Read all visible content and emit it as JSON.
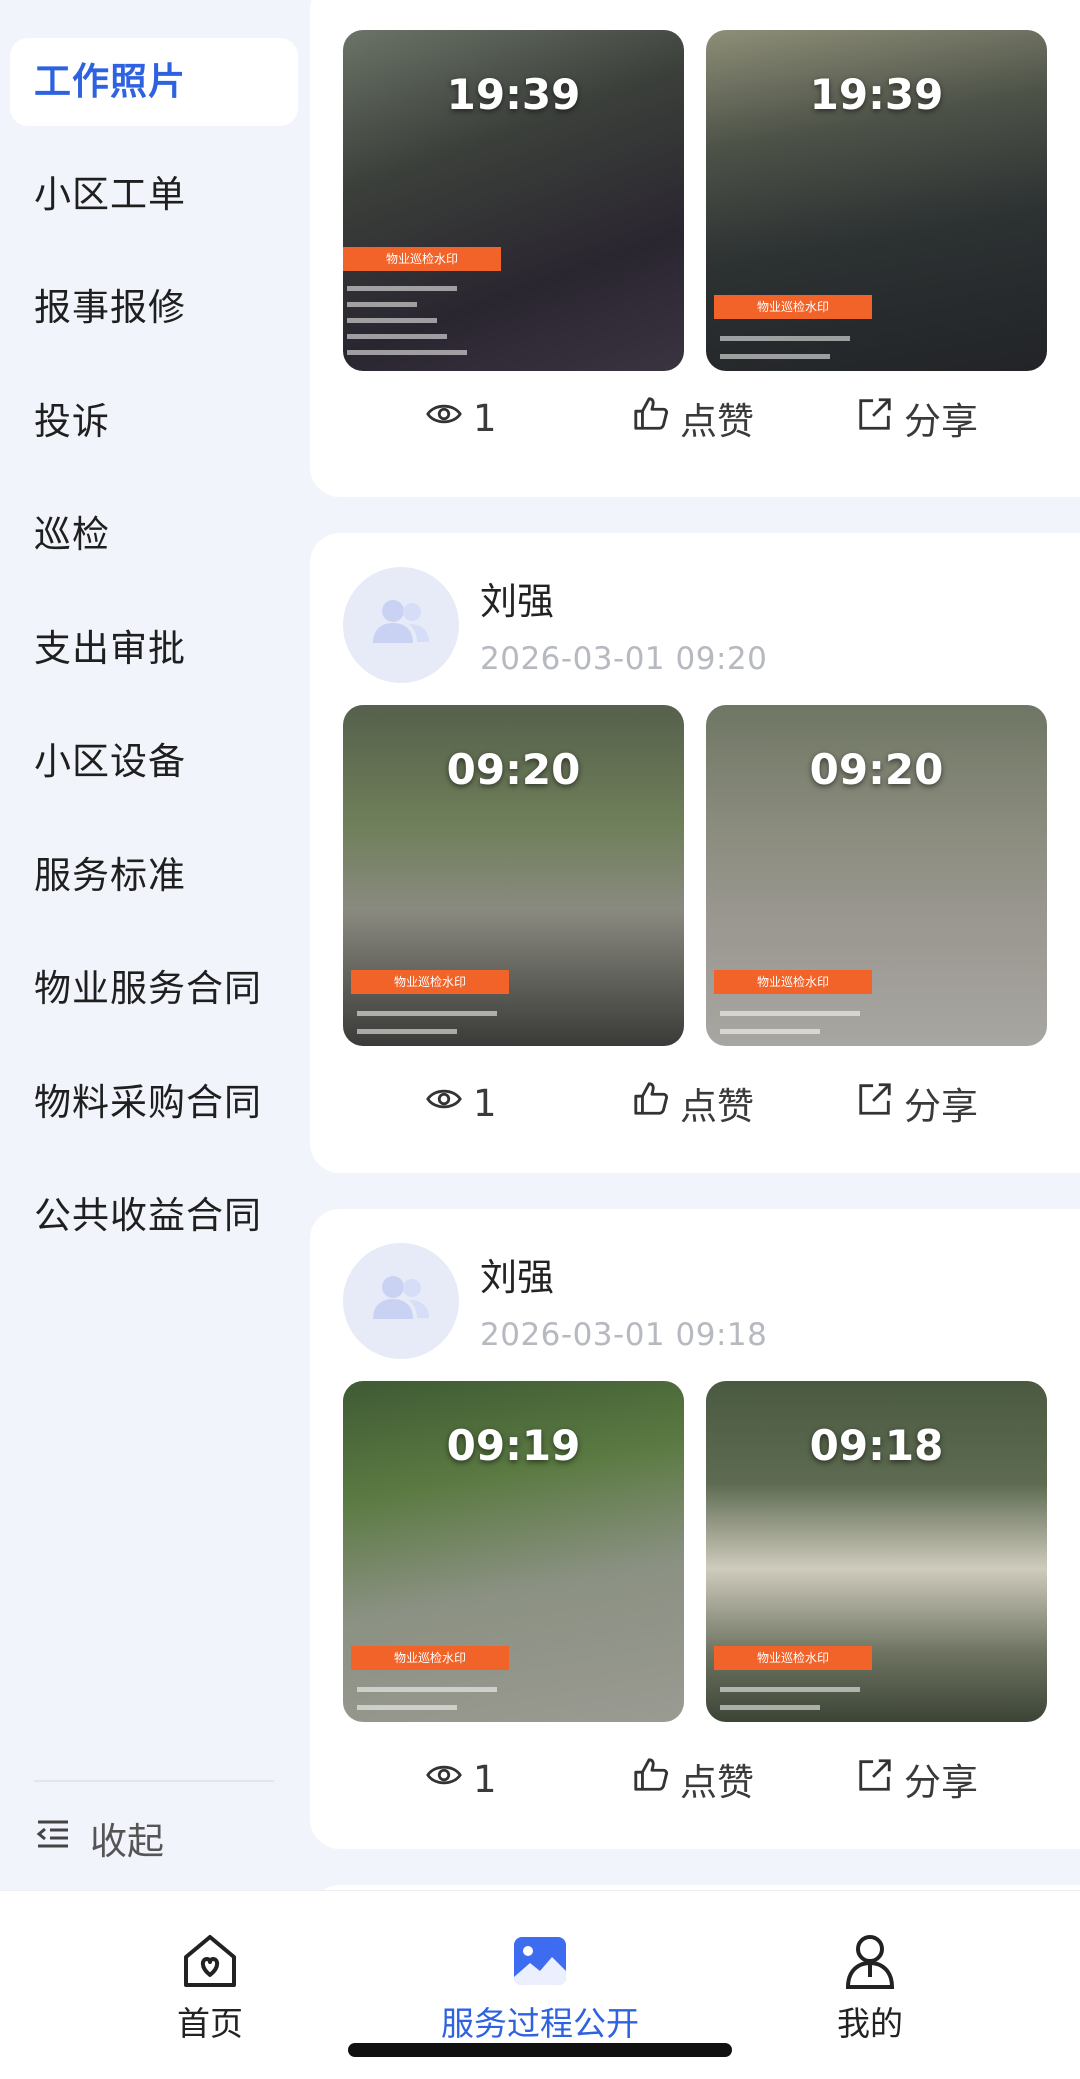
{
  "sidebar": {
    "items": [
      {
        "label": "工作照片",
        "active": true
      },
      {
        "label": "小区工单"
      },
      {
        "label": "报事报修"
      },
      {
        "label": "投诉"
      },
      {
        "label": "巡检"
      },
      {
        "label": "支出审批"
      },
      {
        "label": "小区设备"
      },
      {
        "label": "服务标准"
      },
      {
        "label": "物业服务合同"
      },
      {
        "label": "物料采购合同"
      },
      {
        "label": "公共收益合同"
      }
    ],
    "collapse_label": "收起"
  },
  "feed": {
    "posts": [
      {
        "photos": [
          {
            "time": "19:39",
            "watermark": "物业巡检水印"
          },
          {
            "time": "19:39",
            "watermark": "物业巡检水印"
          }
        ],
        "views": "1",
        "like_label": "点赞",
        "share_label": "分享"
      },
      {
        "author": "刘强",
        "date": "2026-03-01 09:20",
        "photos": [
          {
            "time": "09:20",
            "watermark": "物业巡检水印"
          },
          {
            "time": "09:20",
            "watermark": "物业巡检水印"
          }
        ],
        "views": "1",
        "like_label": "点赞",
        "share_label": "分享"
      },
      {
        "author": "刘强",
        "date": "2026-03-01 09:18",
        "photos": [
          {
            "time": "09:19",
            "watermark": "物业巡检水印"
          },
          {
            "time": "09:18",
            "watermark": "物业巡检水印"
          }
        ],
        "views": "1",
        "like_label": "点赞",
        "share_label": "分享"
      }
    ]
  },
  "tabbar": {
    "tabs": [
      {
        "label": "首页",
        "icon": "home-icon"
      },
      {
        "label": "服务过程公开",
        "icon": "photo-icon",
        "active": true
      },
      {
        "label": "我的",
        "icon": "user-icon"
      }
    ]
  },
  "colors": {
    "accent": "#2f62e0",
    "watermark": "#f2632a",
    "background": "#f1f4fa"
  }
}
